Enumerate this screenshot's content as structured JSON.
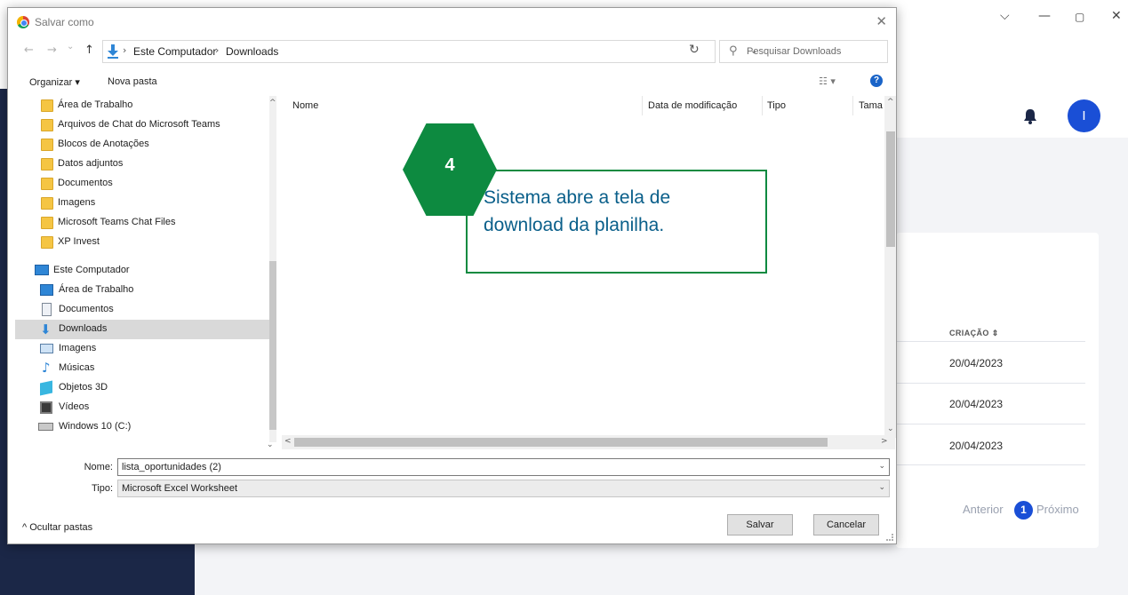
{
  "background_app": {
    "window_controls": [
      "⌵",
      "—",
      "▢",
      "✕"
    ],
    "avatar_initial": "I",
    "table": {
      "header": "CRIAÇÃO ⇕",
      "rows": [
        "20/04/2023",
        "20/04/2023",
        "20/04/2023"
      ]
    },
    "pagination": {
      "prev": "Anterior",
      "current": "1",
      "next": "Próximo"
    }
  },
  "dialog": {
    "title": "Salvar como",
    "close": "✕",
    "nav": {
      "back": "←",
      "forward": "→",
      "recent": "⌄",
      "up": "↑"
    },
    "breadcrumb": [
      "Este Computador",
      "Downloads"
    ],
    "search_placeholder": "Pesquisar Downloads",
    "toolbar": {
      "organize": "Organizar ▾",
      "new_folder": "Nova pasta",
      "view": "☷ ▾",
      "help": "?"
    },
    "quick_access": [
      "Área de Trabalho",
      "Arquivos de Chat do Microsoft Teams",
      "Blocos de Anotações",
      "Datos adjuntos",
      "Documentos",
      "Imagens",
      "Microsoft Teams Chat Files",
      "XP Invest"
    ],
    "this_pc_label": "Este Computador",
    "this_pc_items": [
      {
        "label": "Área de Trabalho",
        "icon": "desktop-icon"
      },
      {
        "label": "Documentos",
        "icon": "documents-icon"
      },
      {
        "label": "Downloads",
        "icon": "downloads-icon"
      },
      {
        "label": "Imagens",
        "icon": "pictures-icon"
      },
      {
        "label": "Músicas",
        "icon": "music-icon"
      },
      {
        "label": "Objetos 3D",
        "icon": "objects-3d-icon"
      },
      {
        "label": "Vídeos",
        "icon": "videos-icon"
      },
      {
        "label": "Windows 10 (C:)",
        "icon": "drive-icon"
      }
    ],
    "selected_nav_item": "Downloads",
    "columns": [
      "Nome",
      "Data de modificação",
      "Tipo",
      "Tama"
    ],
    "file_name_label": "Nome:",
    "file_name_value": "lista_oportunidades (2)",
    "file_type_label": "Tipo:",
    "file_type_value": "Microsoft Excel Worksheet",
    "hide_folders": "^ Ocultar pastas",
    "save_button": "Salvar",
    "cancel_button": "Cancelar"
  },
  "annotation": {
    "step": "4",
    "text": "Sistema abre a tela de download da planilha.",
    "color": "#0d8a40"
  }
}
